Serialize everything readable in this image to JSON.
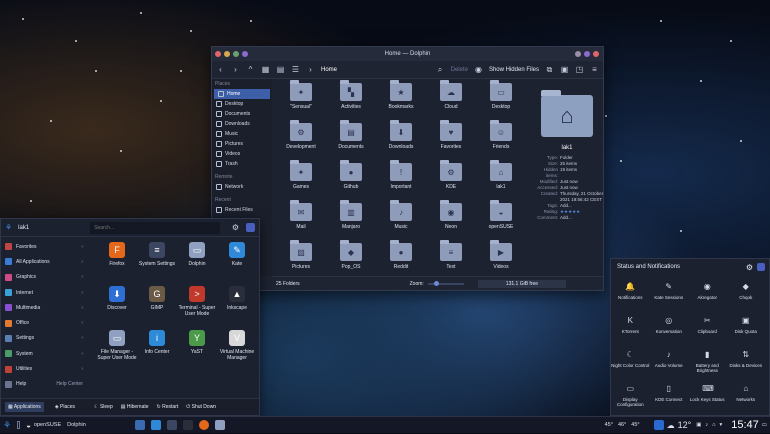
{
  "dolphin": {
    "title": "Home — Dolphin",
    "toolbar": {
      "delete": "Delete",
      "show_hidden": "Show Hidden Files",
      "crumb": "Home"
    },
    "places_header": "Places",
    "remote_header": "Remote",
    "recent_header": "Recent",
    "recent_item": "Recent Files",
    "places": [
      {
        "label": "Home",
        "icon": "home-icon"
      },
      {
        "label": "Desktop",
        "icon": "desktop-icon"
      },
      {
        "label": "Documents",
        "icon": "documents-icon"
      },
      {
        "label": "Downloads",
        "icon": "downloads-icon"
      },
      {
        "label": "Music",
        "icon": "music-icon"
      },
      {
        "label": "Pictures",
        "icon": "pictures-icon"
      },
      {
        "label": "Videos",
        "icon": "videos-icon"
      },
      {
        "label": "Trash",
        "icon": "trash-icon"
      }
    ],
    "remote": [
      {
        "label": "Network",
        "icon": "network-icon"
      }
    ],
    "files": [
      "\"Sensual\"",
      "Activities",
      "Bookmarks",
      "Cloud",
      "Desktop",
      "Development",
      "Documents",
      "Downloads",
      "Favorites",
      "Friends",
      "Games",
      "Github",
      "Important",
      "KDE",
      "lak1",
      "Mail",
      "Manjaro",
      "Music",
      "Neon",
      "openSUSE",
      "Pictures",
      "Pop_OS",
      "Reddit",
      "Text",
      "Videos"
    ],
    "info": {
      "name": "lak1",
      "rows": [
        {
          "k": "Type:",
          "v": "Folder"
        },
        {
          "k": "Size:",
          "v": "25 items"
        },
        {
          "k": "Hidden items:",
          "v": "19 items"
        },
        {
          "k": "Modified:",
          "v": "Just now"
        },
        {
          "k": "Accessed:",
          "v": "Just now"
        },
        {
          "k": "Created:",
          "v": "Thursday, 21 October 2021 18:56:42 CEST"
        },
        {
          "k": "Tags:",
          "v": "Add..."
        },
        {
          "k": "Rating:",
          "v": "★★★★★"
        },
        {
          "k": "Comment:",
          "v": "Add..."
        }
      ]
    },
    "status": {
      "folders": "25 Folders",
      "zoom": "Zoom:",
      "free": "131.1 GiB free"
    }
  },
  "launcher": {
    "user": "lak1",
    "search_placeholder": "Search...",
    "categories": [
      {
        "label": "Favorites",
        "color": "#c04545"
      },
      {
        "label": "All Applications",
        "color": "#3a7bd5"
      },
      {
        "label": "Graphics",
        "color": "#d04a8a"
      },
      {
        "label": "Internet",
        "color": "#3aa0d8"
      },
      {
        "label": "Multimedia",
        "color": "#8a4fd0"
      },
      {
        "label": "Office",
        "color": "#e07a30"
      },
      {
        "label": "Settings",
        "color": "#5a7fb0"
      },
      {
        "label": "System",
        "color": "#4a9a6a"
      },
      {
        "label": "Utilities",
        "color": "#c0403a"
      },
      {
        "label": "Help",
        "color": "#6a7390"
      }
    ],
    "help_center": "Help Center",
    "apps": [
      {
        "label": "Firefox",
        "color": "#e5671a",
        "glyph": "F"
      },
      {
        "label": "System Settings",
        "color": "#3b4660",
        "glyph": "≡"
      },
      {
        "label": "Dolphin",
        "color": "#8fa0c0",
        "glyph": "▭"
      },
      {
        "label": "Kate",
        "color": "#2f89d8",
        "glyph": "✎"
      },
      {
        "label": "Discover",
        "color": "#2d6fd4",
        "glyph": "⬇"
      },
      {
        "label": "GIMP",
        "color": "#6b5a45",
        "glyph": "G"
      },
      {
        "label": "Terminal - Super User Mode",
        "color": "#c0392b",
        "glyph": ">"
      },
      {
        "label": "Inkscape",
        "color": "#2a2e3a",
        "glyph": "▲"
      },
      {
        "label": "File Manager - Super User Mode",
        "color": "#8fa0c0",
        "glyph": "▭"
      },
      {
        "label": "Info Center",
        "color": "#2d8ad8",
        "glyph": "i"
      },
      {
        "label": "YaST",
        "color": "#4a9a4a",
        "glyph": "Y"
      },
      {
        "label": "Virtual Machine Manager",
        "color": "#d8d8d8",
        "glyph": "V"
      }
    ],
    "bottom": {
      "applications": "Applications",
      "places": "Places",
      "sleep": "Sleep",
      "hibernate": "Hibernate",
      "restart": "Restart",
      "shutdown": "Shut Down"
    }
  },
  "statuspanel": {
    "title": "Status and Notifications",
    "items": [
      {
        "label": "Notifications",
        "glyph": "🔔"
      },
      {
        "label": "Kate Sessions",
        "glyph": "✎"
      },
      {
        "label": "Akregator",
        "glyph": "◉"
      },
      {
        "label": "Chqok",
        "glyph": "◆"
      },
      {
        "label": "KTorrent",
        "glyph": "K"
      },
      {
        "label": "Konversation",
        "glyph": "◎"
      },
      {
        "label": "Clipboard",
        "glyph": "✂"
      },
      {
        "label": "Disk Quota",
        "glyph": "▣"
      },
      {
        "label": "Night Color Control",
        "glyph": "☾"
      },
      {
        "label": "Audio Volume",
        "glyph": "♪"
      },
      {
        "label": "Battery and Brightness",
        "glyph": "▮"
      },
      {
        "label": "Disks & Devices",
        "glyph": "⇅"
      },
      {
        "label": "Display Configuration",
        "glyph": "▭"
      },
      {
        "label": "KDE Connect",
        "glyph": "▯"
      },
      {
        "label": "Lock Keys Status",
        "glyph": "⌨"
      },
      {
        "label": "Networks",
        "glyph": "⌂"
      }
    ]
  },
  "taskbar": {
    "os": "openSUSE",
    "app": "Dolphin",
    "temps": [
      "45°",
      "46°",
      "45°"
    ],
    "weather": "12°",
    "clock": "15:47"
  }
}
